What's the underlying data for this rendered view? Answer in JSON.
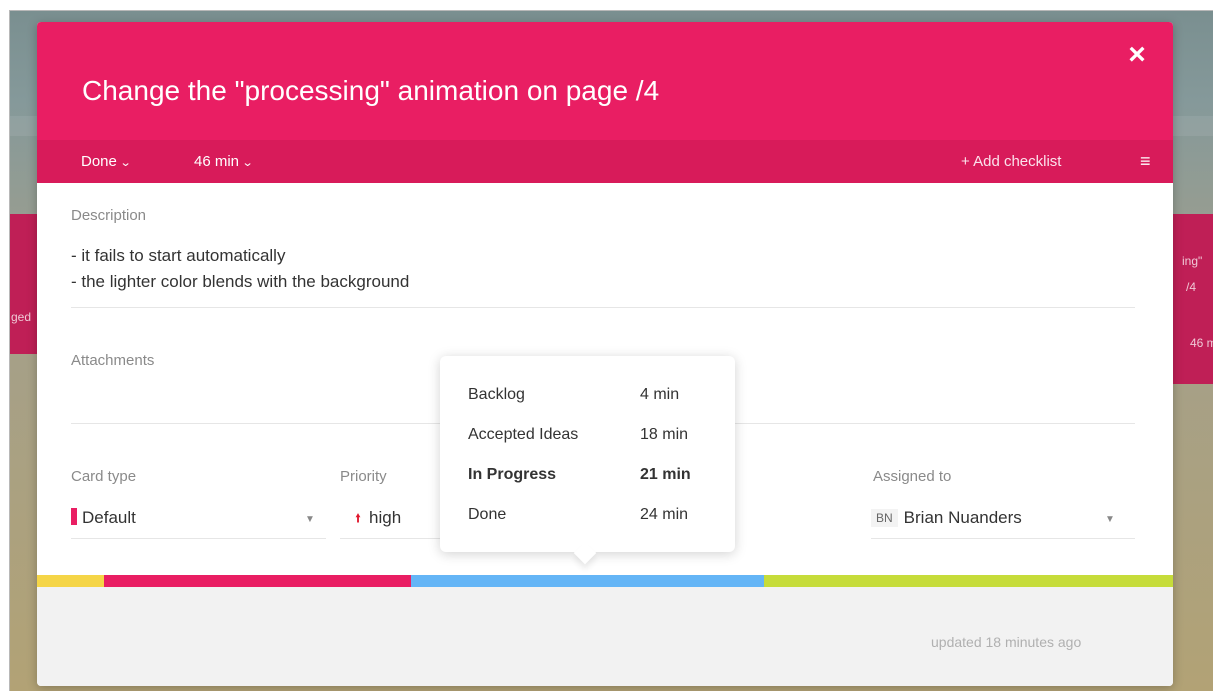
{
  "background": {
    "left_card_text": "ged",
    "right_card_lines": [
      "ing\"",
      "/4",
      "46 m"
    ]
  },
  "modal": {
    "title": "Change the \"processing\" animation on page /4",
    "close_icon": "×",
    "toolbar": {
      "status": "Done",
      "time": "46 min",
      "add_checklist": "+ Add checklist",
      "menu_icon": "≡"
    },
    "description": {
      "label": "Description",
      "lines": [
        "- it fails to start automatically",
        "- the lighter color blends with the background"
      ]
    },
    "attachments": {
      "label": "Attachments"
    },
    "fields": {
      "card_type": {
        "label": "Card type",
        "value": "Default",
        "color": "#e91e63"
      },
      "priority": {
        "label": "Priority",
        "value": "high",
        "icon": "arrow-up-icon",
        "color": "#e0182d"
      },
      "assigned_to": {
        "label": "Assigned to",
        "initials": "BN",
        "value": "Brian Nuanders"
      }
    },
    "timeline_colors": [
      "#f5d547",
      "#e91e63",
      "#64b5f6",
      "#c6dc3a"
    ],
    "footer": {
      "updated": "updated 18 minutes ago"
    }
  },
  "tooltip": {
    "rows": [
      {
        "name": "Backlog",
        "time": "4 min",
        "active": false
      },
      {
        "name": "Accepted Ideas",
        "time": "18 min",
        "active": false
      },
      {
        "name": "In Progress",
        "time": "21 min",
        "active": true
      },
      {
        "name": "Done",
        "time": "24 min",
        "active": false
      }
    ]
  }
}
